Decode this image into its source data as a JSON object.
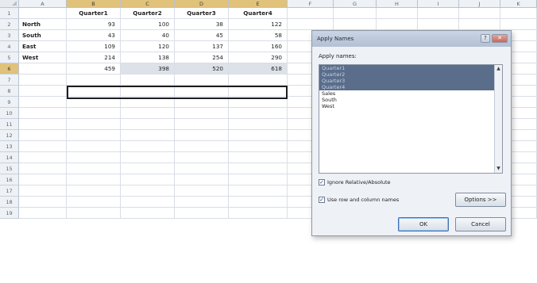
{
  "columns": [
    "A",
    "B",
    "C",
    "D",
    "E",
    "F",
    "G",
    "H",
    "I",
    "J",
    "K"
  ],
  "rows": [
    "1",
    "2",
    "3",
    "4",
    "5",
    "6",
    "7",
    "8",
    "9",
    "10",
    "11",
    "12",
    "13",
    "14",
    "15",
    "16",
    "17",
    "18",
    "19"
  ],
  "headers": [
    "Quarter1",
    "Quarter2",
    "Quarter3",
    "Quarter4"
  ],
  "data": [
    {
      "label": "North",
      "values": [
        "93",
        "100",
        "38",
        "122"
      ]
    },
    {
      "label": "South",
      "values": [
        "43",
        "40",
        "45",
        "58"
      ]
    },
    {
      "label": "East",
      "values": [
        "109",
        "120",
        "137",
        "160"
      ]
    },
    {
      "label": "West",
      "values": [
        "214",
        "138",
        "254",
        "290"
      ]
    }
  ],
  "totals": [
    "459",
    "398",
    "520",
    "618"
  ],
  "dialog": {
    "title": "Apply Names",
    "list_label": "Apply names:",
    "names": [
      "Quarter1",
      "Quarter2",
      "Quarter3",
      "Quarter4",
      "Sales",
      "South",
      "West"
    ],
    "selected_count": 4,
    "ignore_label": "Ignore Relative/Absolute",
    "ignore_checked": true,
    "rowcol_label": "Use row and column names",
    "rowcol_checked": true,
    "options_label": "Options >>",
    "ok_label": "OK",
    "cancel_label": "Cancel",
    "help_glyph": "?",
    "close_glyph": "✕"
  }
}
